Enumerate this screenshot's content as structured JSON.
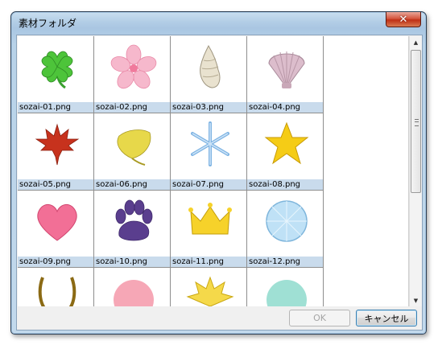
{
  "window": {
    "title": "素材フォルダ"
  },
  "files": [
    {
      "name": "sozai-01.png",
      "icon": "clover-icon"
    },
    {
      "name": "sozai-02.png",
      "icon": "sakura-icon"
    },
    {
      "name": "sozai-03.png",
      "icon": "conch-shell-icon"
    },
    {
      "name": "sozai-04.png",
      "icon": "scallop-shell-icon"
    },
    {
      "name": "sozai-05.png",
      "icon": "maple-leaf-icon"
    },
    {
      "name": "sozai-06.png",
      "icon": "ginkgo-leaf-icon"
    },
    {
      "name": "sozai-07.png",
      "icon": "snowflake-icon"
    },
    {
      "name": "sozai-08.png",
      "icon": "star-icon"
    },
    {
      "name": "sozai-09.png",
      "icon": "heart-icon"
    },
    {
      "name": "sozai-10.png",
      "icon": "paw-icon"
    },
    {
      "name": "sozai-11.png",
      "icon": "crown-icon"
    },
    {
      "name": "sozai-12.png",
      "icon": "diamond-icon"
    },
    {
      "name": "",
      "icon": "horseshoe-icon"
    },
    {
      "name": "",
      "icon": "pink-orb-icon"
    },
    {
      "name": "",
      "icon": "burst-icon"
    },
    {
      "name": "",
      "icon": "mint-orb-icon"
    }
  ],
  "buttons": {
    "ok": "OK",
    "cancel": "キャンセル"
  },
  "close_glyph": "✕",
  "scroll": {
    "up": "▲",
    "down": "▼"
  }
}
